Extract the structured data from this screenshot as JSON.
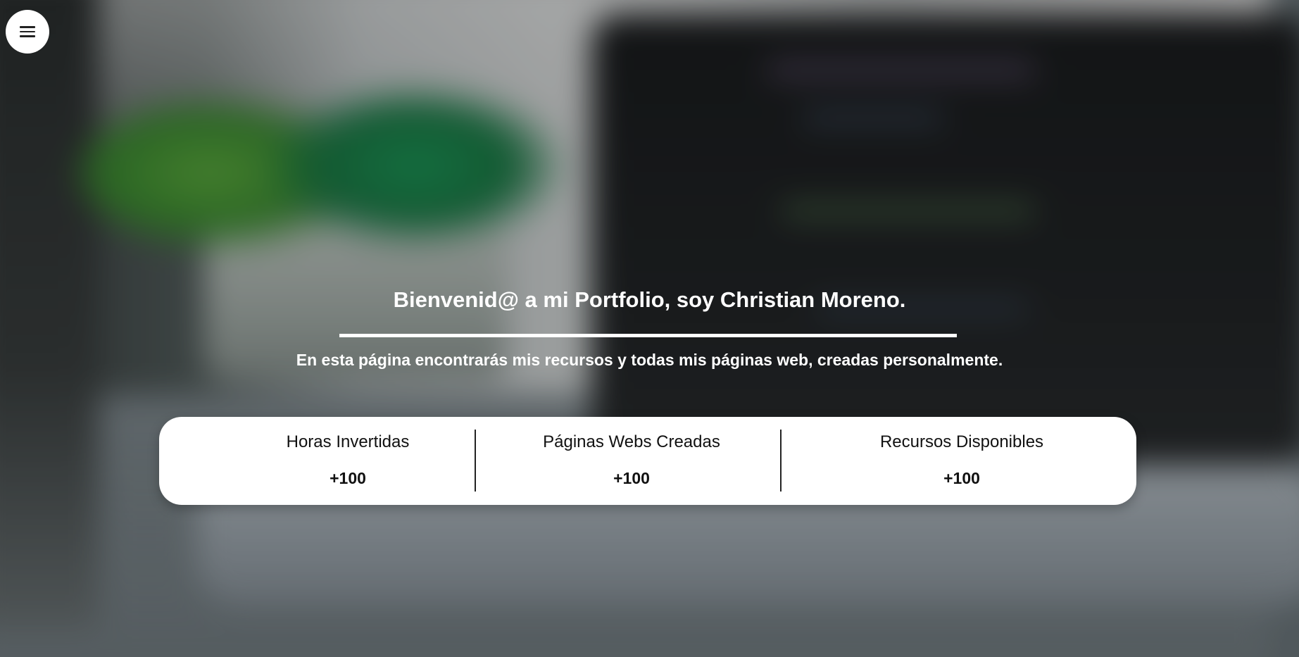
{
  "menu": {
    "icon": "hamburger-menu-icon"
  },
  "hero": {
    "title": "Bienvenid@ a mi Portfolio, soy Christian Moreno.",
    "subtitle": "En esta página encontrarás mis recursos y todas mis páginas web, creadas personalmente."
  },
  "stats": [
    {
      "label": "Horas Invertidas",
      "value": "+100"
    },
    {
      "label": "Páginas Webs Creadas",
      "value": "+100"
    },
    {
      "label": "Recursos Disponibles",
      "value": "+100"
    }
  ],
  "colors": {
    "text_on_background": "#ffffff",
    "card_background": "#ffffff",
    "card_text": "#111111"
  }
}
